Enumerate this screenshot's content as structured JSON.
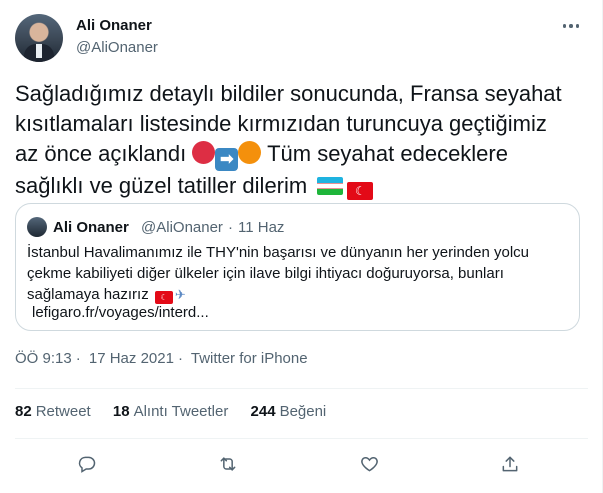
{
  "author": {
    "name": "Ali Onaner",
    "handle": "@AliOnaner"
  },
  "tweet": {
    "line1": "Sağladığımız detaylı bildiler sonucunda, Fransa seyahat",
    "line2": "kısıtlamaları listesinde kırmızıdan turuncuya geçtiğimiz",
    "line3_start": "az önce açıklandı",
    "line3_end": "Tüm seyahat edeceklere",
    "line4": "sağlıklı ve güzel tatiller dilerim"
  },
  "quoted": {
    "name": "Ali Onaner",
    "handle": "@AliOnaner",
    "separator": "·",
    "date": "11 Haz",
    "text": "İstanbul Havalimanımız ile THY'nin başarısı ve dünyanın her yerinden yolcu çekme kabiliyeti diğer ülkeler için ilave bilgi ihtiyacı doğuruyorsa, bunları sağlamaya hazırız",
    "link": "lefigaro.fr/voyages/interd..."
  },
  "meta": {
    "time": "ÖÖ 9:13",
    "sep1": "·",
    "date": "17 Haz 2021",
    "sep2": "·",
    "source": "Twitter for iPhone"
  },
  "stats": {
    "retweets_count": "82",
    "retweets_label": "Retweet",
    "quotes_count": "18",
    "quotes_label": "Alıntı Tweetler",
    "likes_count": "244",
    "likes_label": "Beğeni"
  },
  "icons": [
    "more-icon",
    "reply-icon",
    "retweet-icon",
    "like-icon",
    "share-icon",
    "red-circle-emoji",
    "right-arrow-emoji",
    "orange-circle-emoji",
    "uzbekistan-flag-emoji",
    "turkey-flag-emoji",
    "airplane-emoji"
  ],
  "colors": {
    "text": "#0f1419",
    "secondary": "#536471",
    "border": "#cfd9de"
  }
}
